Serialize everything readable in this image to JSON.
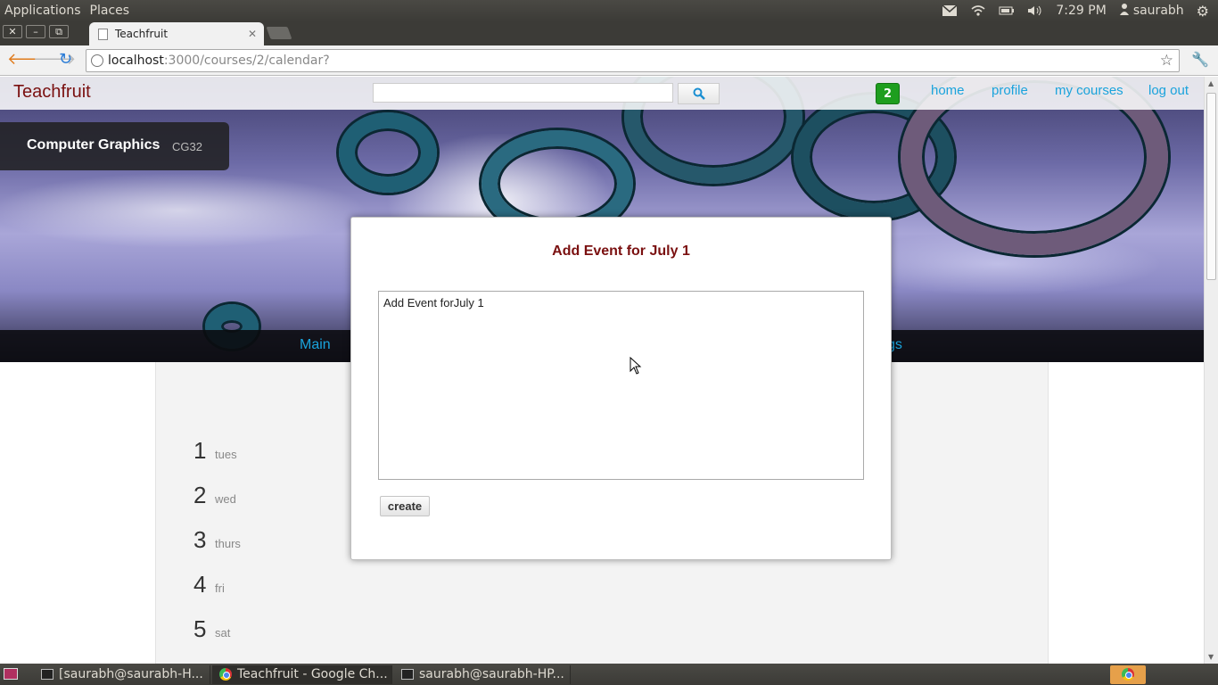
{
  "top_panel": {
    "menus": [
      "Applications",
      "Places"
    ],
    "clock": "7:29 PM",
    "user": "saurabh"
  },
  "browser": {
    "tab_title": "Teachfruit",
    "url_host": "localhost",
    "url_path": ":3000/courses/2/calendar?"
  },
  "site": {
    "brand": "Teachfruit",
    "search_placeholder": "",
    "notification_count": "2",
    "nav": {
      "home": "home",
      "profile": "profile",
      "my_courses": "my courses",
      "log_out": "log out"
    },
    "course_name": "Computer Graphics",
    "course_code": "CG32",
    "subnav_main": "Main",
    "subnav_partial": "gs"
  },
  "calendar": {
    "days": [
      {
        "num": "1",
        "name": "tues"
      },
      {
        "num": "2",
        "name": "wed"
      },
      {
        "num": "3",
        "name": "thurs"
      },
      {
        "num": "4",
        "name": "fri"
      },
      {
        "num": "5",
        "name": "sat"
      }
    ]
  },
  "modal": {
    "title": "Add Event for July 1",
    "textarea_value": "Add Event forJuly 1",
    "create_label": "create"
  },
  "taskbar": {
    "items": [
      "[saurabh@saurabh-H...",
      "Teachfruit - Google Ch...",
      "saurabh@saurabh-HP..."
    ]
  }
}
